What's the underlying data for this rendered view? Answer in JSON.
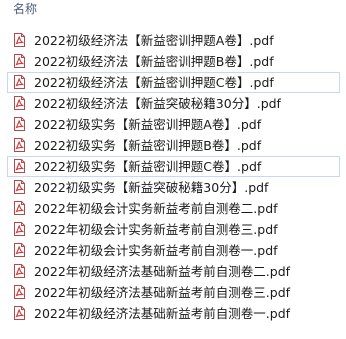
{
  "header": {
    "column_name": "名称"
  },
  "icons": {
    "file_icon": "pdf-file-icon",
    "accent": "#d23b3b"
  },
  "files": [
    {
      "name": "2022初级经济法【新益密训押题A卷】.pdf",
      "selected": false
    },
    {
      "name": "2022初级经济法【新益密训押题B卷】.pdf",
      "selected": false
    },
    {
      "name": "2022初级经济法【新益密训押题C卷】.pdf",
      "selected": true
    },
    {
      "name": "2022初级经济法【新益突破秘籍30分】.pdf",
      "selected": false
    },
    {
      "name": "2022初级实务【新益密训押题A卷】.pdf",
      "selected": false
    },
    {
      "name": "2022初级实务【新益密训押题B卷】.pdf",
      "selected": false
    },
    {
      "name": "2022初级实务【新益密训押题C卷】.pdf",
      "selected": true
    },
    {
      "name": "2022初级实务【新益突破秘籍30分】.pdf",
      "selected": false
    },
    {
      "name": "2022年初级会计实务新益考前自测卷二.pdf",
      "selected": false
    },
    {
      "name": "2022年初级会计实务新益考前自测卷三.pdf",
      "selected": false
    },
    {
      "name": "2022年初级会计实务新益考前自测卷一.pdf",
      "selected": false
    },
    {
      "name": "2022年初级经济法基础新益考前自测卷二.pdf",
      "selected": false
    },
    {
      "name": "2022年初级经济法基础新益考前自测卷三.pdf",
      "selected": false
    },
    {
      "name": "2022年初级经济法基础新益考前自测卷一.pdf",
      "selected": false
    }
  ]
}
